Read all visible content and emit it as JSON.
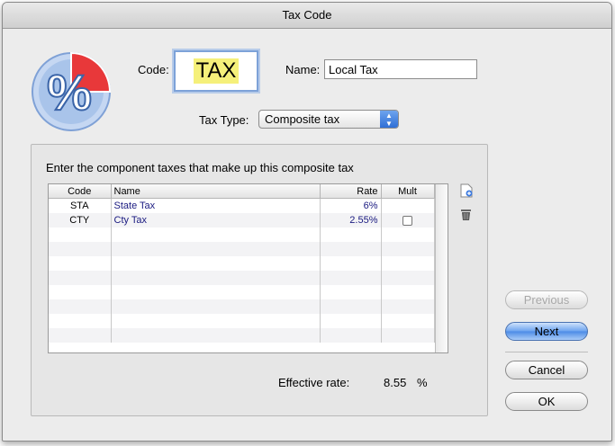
{
  "window": {
    "title": "Tax Code"
  },
  "form": {
    "code_label": "Code:",
    "code_value": "TAX",
    "name_label": "Name:",
    "name_value": "Local Tax",
    "tax_type_label": "Tax Type:",
    "tax_type_value": "Composite tax"
  },
  "components": {
    "instruction": "Enter the component taxes that make up this composite tax",
    "columns": [
      "Code",
      "Name",
      "Rate",
      "Mult"
    ],
    "rows": [
      {
        "code": "STA",
        "name": "State Tax",
        "rate": "6%",
        "mult": null
      },
      {
        "code": "CTY",
        "name": "Cty Tax",
        "rate": "2.55%",
        "mult": false
      }
    ],
    "effective_rate_label": "Effective rate:",
    "effective_rate_value": "8.55",
    "effective_rate_unit": "%"
  },
  "buttons": {
    "previous": "Previous",
    "next": "Next",
    "cancel": "Cancel",
    "ok": "OK"
  },
  "icons": {
    "main": "percent-icon",
    "add": "add-row-icon",
    "delete": "delete-row-icon"
  },
  "colors": {
    "accent": "#4b8be6",
    "highlight": "#f5f07a",
    "pie_red": "#e8383a",
    "badge_blue": "#a9c4ea"
  }
}
